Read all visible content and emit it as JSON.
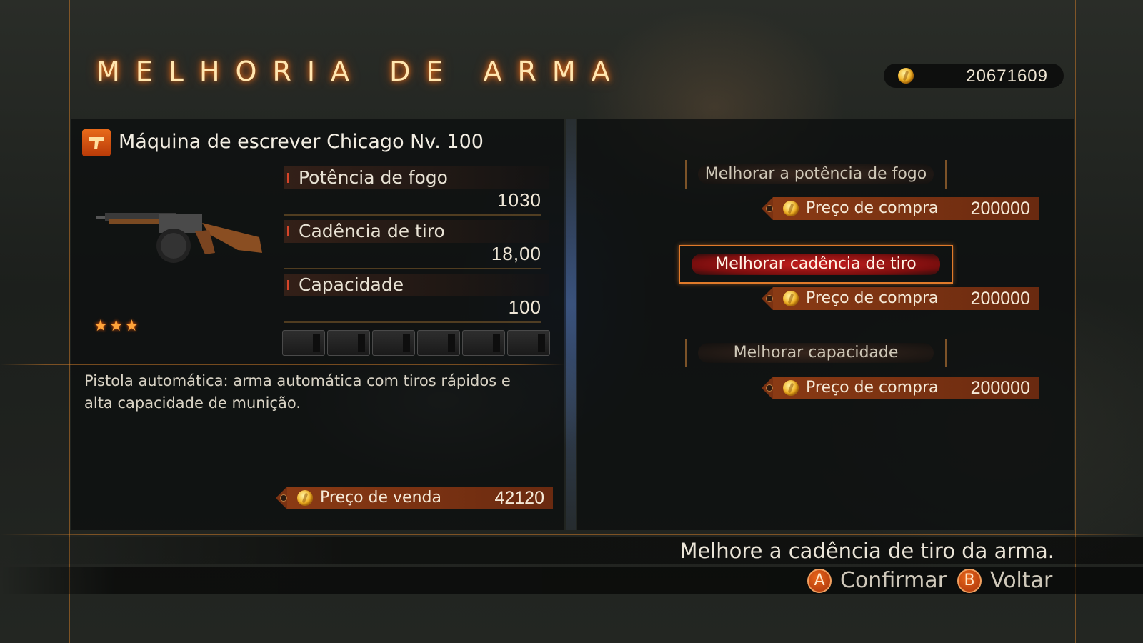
{
  "header": {
    "title": "MELHORIA DE ARMA",
    "money": "20671609"
  },
  "weapon": {
    "icon": "weapon-type-icon",
    "name": "Máquina de escrever Chicago Nv. 100",
    "stars": "★★★",
    "rating_stars": 3,
    "stats": [
      {
        "label": "Potência de fogo",
        "value": "1030"
      },
      {
        "label": "Cadência de tiro",
        "value": "18,00"
      },
      {
        "label": "Capacidade",
        "value": "100"
      }
    ],
    "description": "Pistola automática: arma automática com tiros rápidos e alta capacidade de munição.",
    "sell": {
      "label": "Preço de venda",
      "amount": "42120"
    }
  },
  "upgrades": [
    {
      "label": "Melhorar a potência de fogo",
      "price_label": "Preço de compra",
      "price": "200000",
      "selected": false
    },
    {
      "label": "Melhorar cadência de tiro",
      "price_label": "Preço de compra",
      "price": "200000",
      "selected": true
    },
    {
      "label": "Melhorar capacidade",
      "price_label": "Preço de compra",
      "price": "200000",
      "selected": false
    }
  ],
  "hint": "Melhore a cadência de tiro da arma.",
  "controls": [
    {
      "button": "A",
      "label": "Confirmar"
    },
    {
      "button": "B",
      "label": "Voltar"
    }
  ],
  "colors": {
    "accent": "#e07a2a",
    "selected": "#c81e1e",
    "price_bar": "#8a3a14"
  }
}
